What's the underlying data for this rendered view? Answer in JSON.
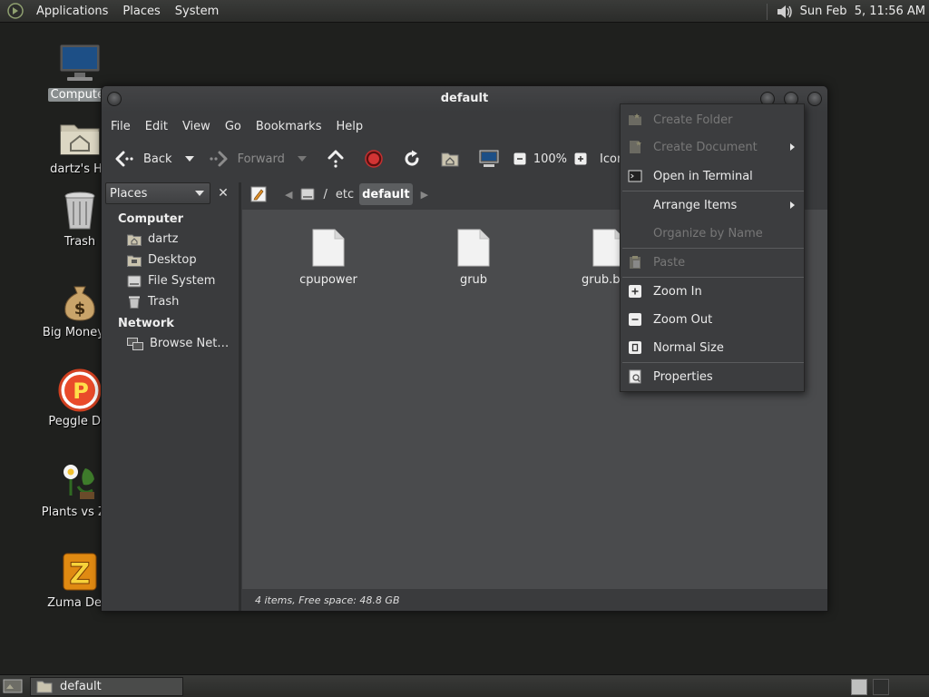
{
  "top_panel": {
    "menus": [
      "Applications",
      "Places",
      "System"
    ],
    "clock": "Sun Feb  5, 11:56 AM"
  },
  "desktop_icons": [
    {
      "label": "Computer",
      "icon": "computer-icon"
    },
    {
      "label": "dartz's Ho",
      "icon": "home-folder-icon"
    },
    {
      "label": "Trash",
      "icon": "trash-icon"
    },
    {
      "label": "Big Money D",
      "icon": "money-bag-icon"
    },
    {
      "label": "Peggle Del",
      "icon": "peggle-icon"
    },
    {
      "label": "Plants vs Zor",
      "icon": "plants-vs-zombies-icon"
    },
    {
      "label": "Zuma Delu",
      "icon": "zuma-icon"
    }
  ],
  "window": {
    "title": "default",
    "menubar": [
      "File",
      "Edit",
      "View",
      "Go",
      "Bookmarks",
      "Help"
    ],
    "toolbar": {
      "back": "Back",
      "forward": "Forward",
      "zoom": "100%",
      "view_mode": "Icon V"
    },
    "sidebar": {
      "selector": "Places",
      "headings": {
        "computer": "Computer",
        "network": "Network"
      },
      "items": [
        {
          "label": "dartz",
          "icon": "home-icon"
        },
        {
          "label": "Desktop",
          "icon": "desktop-icon"
        },
        {
          "label": "File System",
          "icon": "drive-icon"
        },
        {
          "label": "Trash",
          "icon": "trash-icon"
        },
        {
          "label": "Browse Net…",
          "icon": "network-icon"
        }
      ]
    },
    "location": {
      "separator": "/",
      "crumbs": [
        "etc",
        "default"
      ]
    },
    "files": [
      {
        "name": "cpupower"
      },
      {
        "name": "grub"
      },
      {
        "name": "grub.b"
      }
    ],
    "status": "4 items, Free space: 48.8 GB"
  },
  "context_menu": {
    "items": [
      {
        "label": "Create Folder",
        "enabled": false,
        "submenu": false
      },
      {
        "label": "Create Document",
        "enabled": false,
        "submenu": true
      },
      {
        "label": "Open in Terminal",
        "enabled": true,
        "submenu": false
      },
      {
        "label": "Arrange Items",
        "enabled": true,
        "submenu": true
      },
      {
        "label": "Organize by Name",
        "enabled": false,
        "submenu": false
      },
      {
        "label": "Paste",
        "enabled": false,
        "submenu": false
      },
      {
        "label": "Zoom In",
        "enabled": true,
        "submenu": false
      },
      {
        "label": "Zoom Out",
        "enabled": true,
        "submenu": false
      },
      {
        "label": "Normal Size",
        "enabled": true,
        "submenu": false
      },
      {
        "label": "Properties",
        "enabled": true,
        "submenu": false
      }
    ]
  },
  "taskbar": {
    "window_button": "default"
  }
}
